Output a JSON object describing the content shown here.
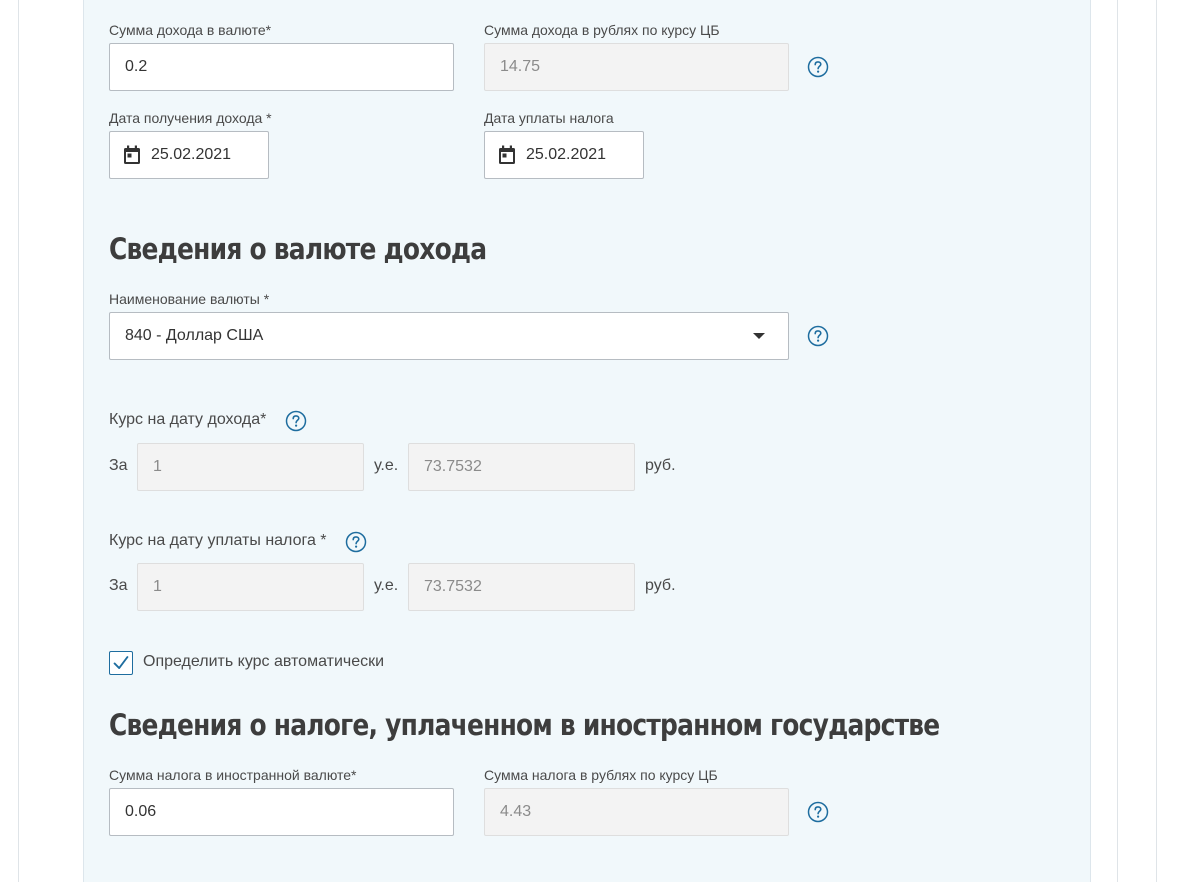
{
  "income": {
    "amount_currency_label": "Сумма дохода в валюте*",
    "amount_currency_value": "0.2",
    "amount_rub_label": "Сумма дохода в рублях по курсу ЦБ",
    "amount_rub_value": "14.75",
    "income_date_label": "Дата получения дохода *",
    "income_date_value": "25.02.2021",
    "tax_paid_date_label": "Дата уплаты налога",
    "tax_paid_date_value": "25.02.2021"
  },
  "currency_section": {
    "heading": "Сведения о валюте дохода",
    "currency_label": "Наименование валюты *",
    "currency_value": "840 - Доллар США",
    "rate_income_label": "Курс на дату дохода*",
    "rate_income_for_label": "За",
    "rate_income_units_value": "1",
    "rate_income_units_suffix": "у.е.",
    "rate_income_rub_value": "73.7532",
    "rate_income_rub_suffix": "руб.",
    "rate_tax_label": "Курс на дату уплаты налога *",
    "rate_tax_for_label": "За",
    "rate_tax_units_value": "1",
    "rate_tax_units_suffix": "у.е.",
    "rate_tax_rub_value": "73.7532",
    "rate_tax_rub_suffix": "руб.",
    "auto_rate_label": "Определить курс автоматически",
    "auto_rate_checked": true
  },
  "foreign_tax_section": {
    "heading": "Сведения о налоге, уплаченном в иностранном государстве",
    "tax_currency_label": "Сумма налога в иностранной валюте*",
    "tax_currency_value": "0.06",
    "tax_rub_label": "Сумма налога в рублях по курсу ЦБ",
    "tax_rub_value": "4.43"
  },
  "colors": {
    "panel_bg": "#f1f8fb",
    "accent": "#1e6d9f",
    "readonly_bg": "#f3f3f3"
  },
  "icons": {
    "help": "question-circle-icon",
    "calendar": "calendar-icon",
    "dropdown": "chevron-down-icon",
    "check": "check-icon"
  }
}
